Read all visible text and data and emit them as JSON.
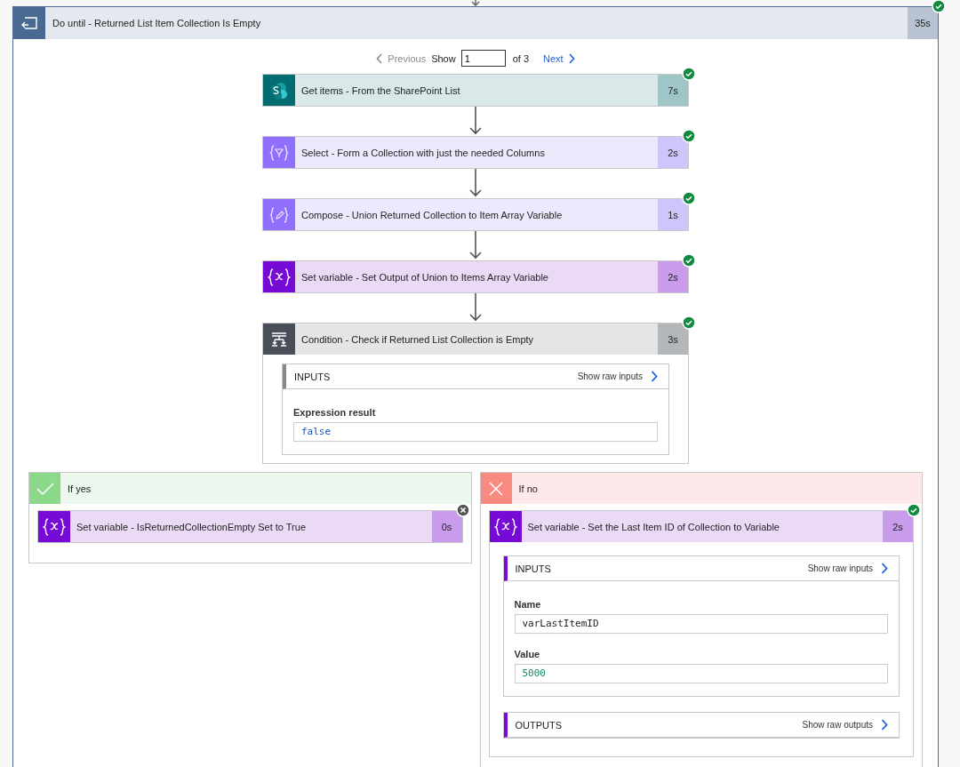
{
  "loop": {
    "title": "Do until - Returned List Item Collection Is Empty",
    "duration": "35s",
    "succeeded": true
  },
  "pager": {
    "previous": {
      "label": "Previous",
      "disabled": true
    },
    "show_label": "Show",
    "page": "1",
    "total": "of 3",
    "next": {
      "label": "Next",
      "disabled": false
    }
  },
  "actions": [
    {
      "kind": "sharepoint",
      "title": "Get items - From the SharePoint List",
      "duration": "7s",
      "succeeded": true
    },
    {
      "kind": "select",
      "title": "Select - Form a Collection with just the needed Columns",
      "duration": "2s",
      "succeeded": true
    },
    {
      "kind": "compose",
      "title": "Compose - Union Returned Collection to Item Array Variable",
      "duration": "1s",
      "succeeded": true
    },
    {
      "kind": "variable",
      "title": "Set variable - Set Output of Union to Items Array Variable",
      "duration": "2s",
      "succeeded": true
    },
    {
      "kind": "condition",
      "title": "Condition - Check if Returned List Collection is Empty",
      "duration": "3s",
      "succeeded": true,
      "panels": [
        {
          "heading": "INPUTS",
          "link": "Show raw inputs",
          "fields": [
            {
              "label": "Expression result",
              "value": "false",
              "kind": "boolean"
            }
          ]
        }
      ]
    }
  ],
  "branches": [
    {
      "kind": "yes",
      "label": "If yes",
      "actions": [
        {
          "kind": "variable",
          "title": "Set variable - IsReturnedCollectionEmpty Set to True",
          "duration": "0s",
          "succeeded": false
        }
      ]
    },
    {
      "kind": "no",
      "label": "If no",
      "actions": [
        {
          "kind": "variable",
          "title": "Set variable - Set the Last Item ID of Collection to Variable",
          "duration": "2s",
          "succeeded": true,
          "panels": [
            {
              "heading": "INPUTS",
              "link": "Show raw inputs",
              "fields": [
                {
                  "label": "Name",
                  "value": "varLastItemID",
                  "kind": "string"
                },
                {
                  "label": "Value",
                  "value": "5000",
                  "kind": "number"
                }
              ]
            },
            {
              "heading": "OUTPUTS",
              "link": "Show raw outputs"
            }
          ]
        }
      ]
    }
  ]
}
